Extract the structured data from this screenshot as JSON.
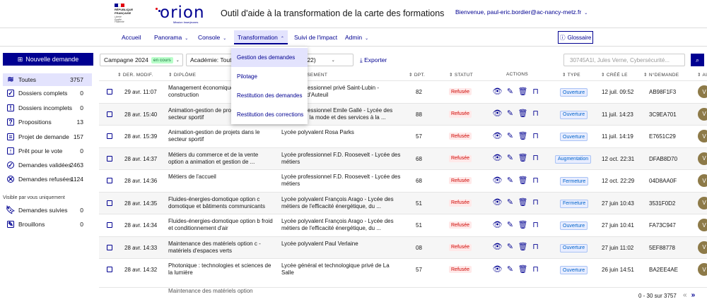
{
  "header": {
    "republique_lines": [
      "RÉPUBLIQUE",
      "FRANÇAISE"
    ],
    "devise": "Liberté Égalité Fraternité",
    "logo": "orion",
    "logo_subtitle": "Mission Inserjeunes",
    "tagline": "Outil d'aide à la transformation de la carte des formations",
    "user": "Bienvenue, paul-eric.bordier@ac-nancy-metz.fr",
    "flag_colors": [
      "#000091",
      "#ffffff",
      "#e1000f"
    ]
  },
  "nav": {
    "accueil": "Accueil",
    "panorama": "Panorama",
    "console": "Console",
    "transformation": "Transformation",
    "suivi": "Suivi de l'impact",
    "admin": "Admin",
    "glossaire": "Glossaire"
  },
  "dropdown": {
    "items": [
      "Gestion des demandes",
      "Pilotage",
      "Restitution des demandes",
      "Restitution des corrections"
    ]
  },
  "sidebar": {
    "new_request": "Nouvelle demande",
    "items": [
      {
        "label": "Toutes",
        "count": "3757",
        "icon": "layers-icon"
      },
      {
        "label": "Dossiers complets",
        "count": "0",
        "icon": "check-box-icon"
      },
      {
        "label": "Dossiers incomplets",
        "count": "0",
        "icon": "warning-doc-icon"
      },
      {
        "label": "Propositions",
        "count": "13",
        "icon": "question-doc-icon"
      },
      {
        "label": "Projet de demande",
        "count": "157",
        "icon": "doc-icon"
      },
      {
        "label": "Prêt pour le vote",
        "count": "0",
        "icon": "vote-icon"
      },
      {
        "label": "Demandes validées",
        "count": "2463",
        "icon": "check-circle-icon"
      },
      {
        "label": "Demandes refusées",
        "count": "1124",
        "icon": "cross-circle-icon"
      }
    ],
    "section_label": "Visible par vous uniquement",
    "private_items": [
      {
        "label": "Demandes suivies",
        "count": "0",
        "icon": "bookmark-icon"
      },
      {
        "label": "Brouillons",
        "count": "0",
        "icon": "draft-icon"
      }
    ]
  },
  "filters": {
    "campagne": "Campagne 2024",
    "campagne_badge": "en cours",
    "academie": "Académie: Toute",
    "third": "s (22)",
    "export": "Exporter",
    "search_placeholder": "30745A1I, Jules Verne, Cybersécurité..."
  },
  "table": {
    "headers": {
      "modif": "DER. MODIF.",
      "diplome": "DIPLÔME",
      "etab": "ÉTABLISSEMENT",
      "dpt": "DPT.",
      "statut": "STATUT",
      "actions": "ACTIONS",
      "type": "TYPE",
      "cree": "CRÉÉ LE",
      "numero": "N°DEMANDE",
      "auteur": "AU"
    },
    "rows": [
      {
        "modif": "29 avr. 11:07",
        "diplome": "Management économique de la construction",
        "etab": "Lycée professionnel privé Saint-Lubin - Apprentis d'Auteuil",
        "dpt": "82",
        "statut": "Refusée",
        "type": "Ouverture",
        "cree": "12 juil. 09:52",
        "numero": "AB98F1F3",
        "avatar": "V"
      },
      {
        "modif": "28 avr. 15:40",
        "diplome": "Animation-gestion de projets dans le secteur sportif",
        "etab": "Lycée professionnel Emile Gallé - Lycée des métiers de la mode et des services à la ...",
        "dpt": "88",
        "statut": "Refusée",
        "type": "Ouverture",
        "cree": "11 juil. 14:23",
        "numero": "3C9EA701",
        "avatar": "V"
      },
      {
        "modif": "28 avr. 15:39",
        "diplome": "Animation-gestion de projets dans le secteur sportif",
        "etab": "Lycée polyvalent Rosa Parks",
        "dpt": "57",
        "statut": "Refusée",
        "type": "Ouverture",
        "cree": "11 juil. 14:19",
        "numero": "E7651C29",
        "avatar": "V"
      },
      {
        "modif": "28 avr. 14:37",
        "diplome": "Métiers du commerce et de la vente option a animation et gestion de ...",
        "etab": "Lycée professionnel F.D. Roosevelt - Lycée des métiers",
        "dpt": "68",
        "statut": "Refusée",
        "type": "Augmentation",
        "cree": "12 oct. 22:31",
        "numero": "DFAB8D70",
        "avatar": "V"
      },
      {
        "modif": "28 avr. 14:36",
        "diplome": "Métiers de l'accueil",
        "etab": "Lycée professionnel F.D. Roosevelt - Lycée des métiers",
        "dpt": "68",
        "statut": "Refusée",
        "type": "Fermeture",
        "cree": "12 oct. 22:29",
        "numero": "04D8AA0F",
        "avatar": "V"
      },
      {
        "modif": "28 avr. 14:35",
        "diplome": "Fluides-énergies-domotique option c domotique et bâtiments communicants",
        "etab": "Lycée polyvalent François Arago - Lycée des métiers de l'efficacité énergétique, du ...",
        "dpt": "51",
        "statut": "Refusée",
        "type": "Fermeture",
        "cree": "27 juin 10:43",
        "numero": "3531F0D2",
        "avatar": "V"
      },
      {
        "modif": "28 avr. 14:34",
        "diplome": "Fluides-énergies-domotique option b froid et conditionnement d'air",
        "etab": "Lycée polyvalent François Arago - Lycée des métiers de l'efficacité énergétique, du ...",
        "dpt": "51",
        "statut": "Refusée",
        "type": "Ouverture",
        "cree": "27 juin 10:41",
        "numero": "FA73C947",
        "avatar": "V"
      },
      {
        "modif": "28 avr. 14:33",
        "diplome": "Maintenance des matériels option c - matériels d'espaces verts",
        "etab": "Lycée polyvalent Paul Verlaine",
        "dpt": "08",
        "statut": "Refusée",
        "type": "Ouverture",
        "cree": "27 juin 11:02",
        "numero": "5EF88778",
        "avatar": "V"
      },
      {
        "modif": "28 avr. 14:32",
        "diplome": "Photonique : technologies et sciences de la lumière",
        "etab": "Lycée général et technologique privé de La Salle",
        "dpt": "57",
        "statut": "Refusée",
        "type": "Ouverture",
        "cree": "26 juin 14:51",
        "numero": "BA2EE4AE",
        "avatar": "V"
      }
    ],
    "partial_row": "Maintenance des matériels option"
  },
  "pagination": {
    "text": "0 - 30 sur 3757"
  }
}
